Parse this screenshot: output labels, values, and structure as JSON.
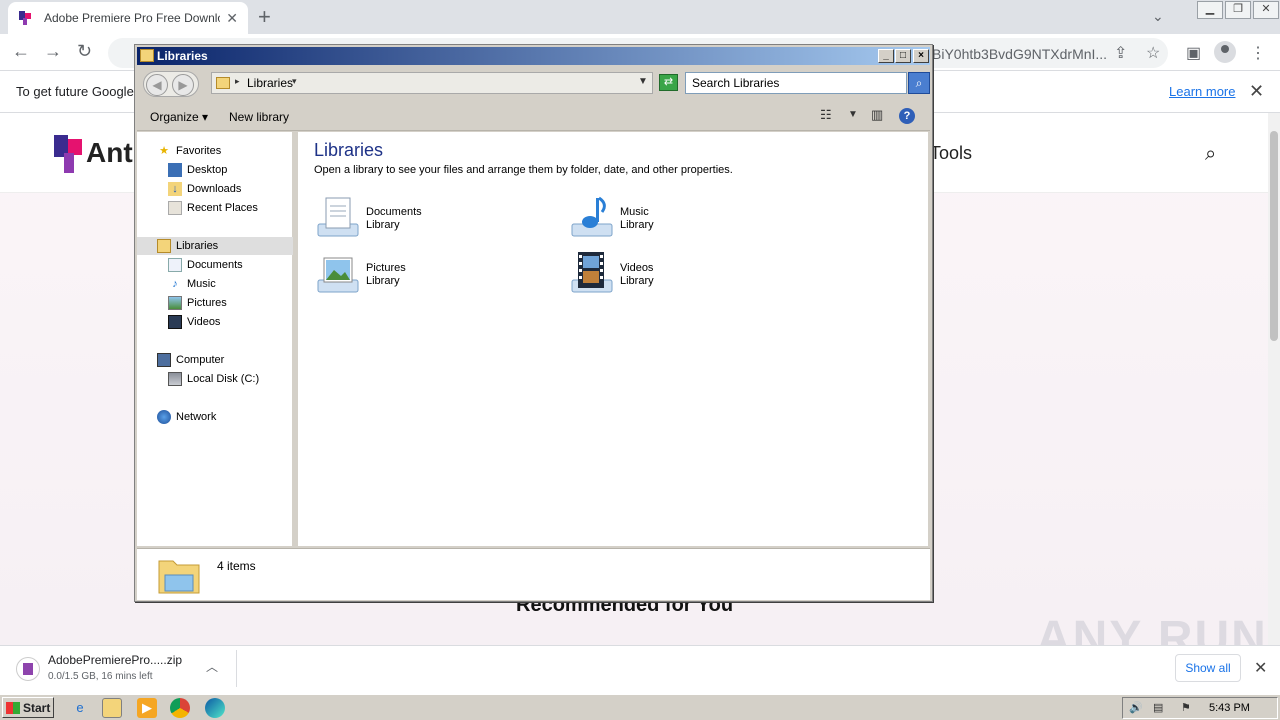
{
  "browser": {
    "tab_title": "Adobe Premiere Pro Free Download",
    "url_fragment": "BiY0htb3BvdG9NTXdrMnI...",
    "info_bar_text": "To get future Google",
    "learn_more": "Learn more"
  },
  "website": {
    "logo_text": "Ant",
    "nav_tools": "Tools",
    "recommended": "Recommended for You",
    "watermark": "ANY RUN"
  },
  "explorer": {
    "title": "Libraries",
    "address": "Libraries",
    "search_placeholder": "Search Libraries",
    "organize": "Organize",
    "new_library": "New library",
    "nav": {
      "favorites": "Favorites",
      "desktop": "Desktop",
      "downloads": "Downloads",
      "recent_places": "Recent Places",
      "libraries": "Libraries",
      "documents": "Documents",
      "music": "Music",
      "pictures": "Pictures",
      "videos": "Videos",
      "computer": "Computer",
      "local_disk": "Local Disk (C:)",
      "network": "Network"
    },
    "content_title": "Libraries",
    "content_desc": "Open a library to see your files and arrange them by folder, date, and other properties.",
    "libraries": [
      {
        "name": "Documents",
        "kind": "Library"
      },
      {
        "name": "Music",
        "kind": "Library"
      },
      {
        "name": "Pictures",
        "kind": "Library"
      },
      {
        "name": "Videos",
        "kind": "Library"
      }
    ],
    "item_count": "4 items"
  },
  "downloads": {
    "file_name": "AdobePremierePro.....zip",
    "status": "0.0/1.5 GB, 16 mins left",
    "show_all": "Show all"
  },
  "taskbar": {
    "start": "Start",
    "clock": "5:43 PM"
  },
  "colors": {
    "title_gradient_start": "#0a246a",
    "link_blue": "#1a73e8",
    "content_title": "#1e3287"
  }
}
